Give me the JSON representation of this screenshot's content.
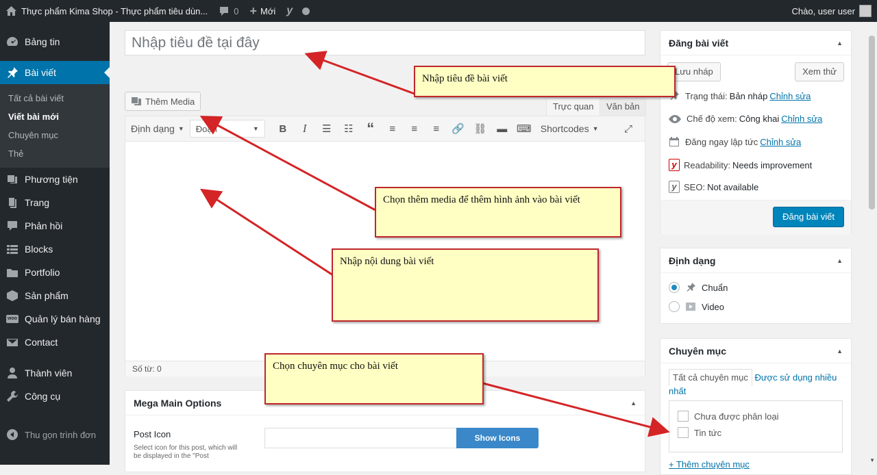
{
  "adminbar": {
    "site_name": "Thực phẩm Kima Shop - Thực phẩm tiêu dùn...",
    "comments_count": "0",
    "new_label": "Mới",
    "greeting": "Chào, user user"
  },
  "sidebar": {
    "items": [
      {
        "label": "Bảng tin",
        "icon": "dashboard-icon"
      },
      {
        "label": "Bài viết",
        "icon": "pin-icon"
      },
      {
        "label": "Phương tiện",
        "icon": "media-icon"
      },
      {
        "label": "Trang",
        "icon": "page-icon"
      },
      {
        "label": "Phản hồi",
        "icon": "comment-icon"
      },
      {
        "label": "Blocks",
        "icon": "blocks-icon"
      },
      {
        "label": "Portfolio",
        "icon": "folder-icon"
      },
      {
        "label": "Sản phẩm",
        "icon": "box-icon"
      },
      {
        "label": "Quản lý bán hàng",
        "icon": "woo-icon"
      },
      {
        "label": "Contact",
        "icon": "mail-icon"
      },
      {
        "label": "Thành viên",
        "icon": "user-icon"
      },
      {
        "label": "Công cụ",
        "icon": "wrench-icon"
      }
    ],
    "submenu": [
      "Tất cả bài viết",
      "Viết bài mới",
      "Chuyên mục",
      "Thẻ"
    ],
    "collapse": "Thu gọn trình đơn"
  },
  "editor": {
    "title_placeholder": "Nhập tiêu đề tại đây",
    "add_media": "Thêm Media",
    "tab_visual": "Trực quan",
    "tab_text": "Văn bản",
    "format_label": "Định dạng",
    "paragraph_label": "Đoạn",
    "shortcodes_label": "Shortcodes",
    "word_count": "Số từ: 0"
  },
  "mega": {
    "title": "Mega Main Options",
    "post_icon_label": "Post Icon",
    "post_icon_desc": "Select icon for this post, which will be displayed in the \"Post",
    "show_icons": "Show Icons"
  },
  "publish": {
    "title": "Đăng bài viết",
    "save_draft": "Lưu nháp",
    "preview": "Xem thử",
    "status_label": "Trạng thái:",
    "status_value": "Bản nháp",
    "visibility_label": "Chế độ xem:",
    "visibility_value": "Công khai",
    "schedule_label": "Đăng ngay lập tức",
    "edit_link": "Chỉnh sửa",
    "readability_label": "Readability:",
    "readability_value": "Needs improvement",
    "seo_label": "SEO:",
    "seo_value": "Not available",
    "publish_btn": "Đăng bài viết"
  },
  "format_box": {
    "title": "Định dạng",
    "options": [
      "Chuẩn",
      "Video"
    ]
  },
  "category_box": {
    "title": "Chuyên mục",
    "tab_all": "Tất cả chuyên mục",
    "tab_most": "Được sử dụng nhiều nhất",
    "items": [
      "Chưa được phân loại",
      "Tin tức"
    ],
    "add_link": "+ Thêm chuyên mục"
  },
  "notes": {
    "title_note": "Nhập tiêu đề bài viết",
    "media_note": "Chọn thêm media để thêm hình ảnh vào bài viết",
    "content_note": "Nhập nội dung bài viết",
    "category_note": "Chọn chuyên mục cho bài viết"
  },
  "colors": {
    "admin_dark": "#23282d",
    "accent": "#0073aa",
    "note_bg": "#ffffc4",
    "note_border": "#c0262c"
  }
}
